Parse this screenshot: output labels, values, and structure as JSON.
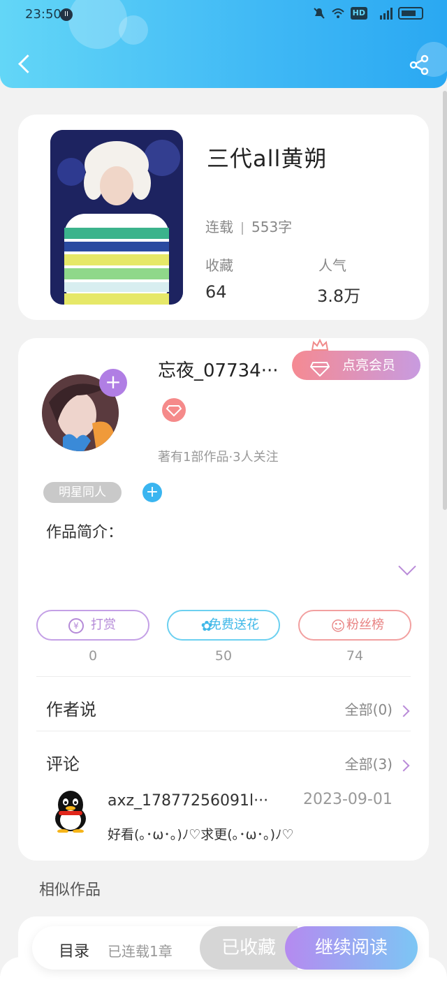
{
  "status_bar": {
    "time": "23:50",
    "dot_label": "II",
    "network": "HD",
    "signal": "56"
  },
  "colors": {
    "header_start": "#63d6f7",
    "header_end": "#2aa8f2",
    "accent_purple": "#b58ad8",
    "accent_blue": "#3fb8e8",
    "accent_red": "#e88282"
  },
  "book": {
    "title": "三代all黄朔",
    "status": "连载",
    "words": "553字",
    "stats": [
      {
        "label": "收藏",
        "value": "64"
      },
      {
        "label": "人气",
        "value": "3.8万"
      }
    ]
  },
  "author": {
    "name": "忘夜_07734···",
    "vip_button": "点亮会员",
    "summary": "著有1部作品·3人关注",
    "tag": "明星同人",
    "tag_add": "+",
    "avatar_add": "+"
  },
  "intro": {
    "label": "作品简介："
  },
  "actions": [
    {
      "icon": "yen-icon",
      "glyph": "¥",
      "label": "打赏",
      "count": "0"
    },
    {
      "icon": "flower-icon",
      "glyph": "✿",
      "label": "免费送花",
      "count": "50"
    },
    {
      "icon": "person-icon",
      "glyph": "☺",
      "label": "粉丝榜",
      "count": "74"
    }
  ],
  "author_says": {
    "title": "作者说",
    "more": "全部(0)"
  },
  "comments": {
    "title": "评论",
    "more": "全部(3)",
    "items": [
      {
        "user": "axz_17877256091l···",
        "date": "2023-09-01",
        "text": "好看(｡･ω･｡)ﾉ♡求更(｡･ω･｡)ﾉ♡"
      }
    ]
  },
  "similar": {
    "label": "相似作品"
  },
  "bottom_bar": {
    "toc": "目录",
    "chapters": "已连载1章",
    "collected": "已收藏",
    "read": "继续阅读"
  }
}
